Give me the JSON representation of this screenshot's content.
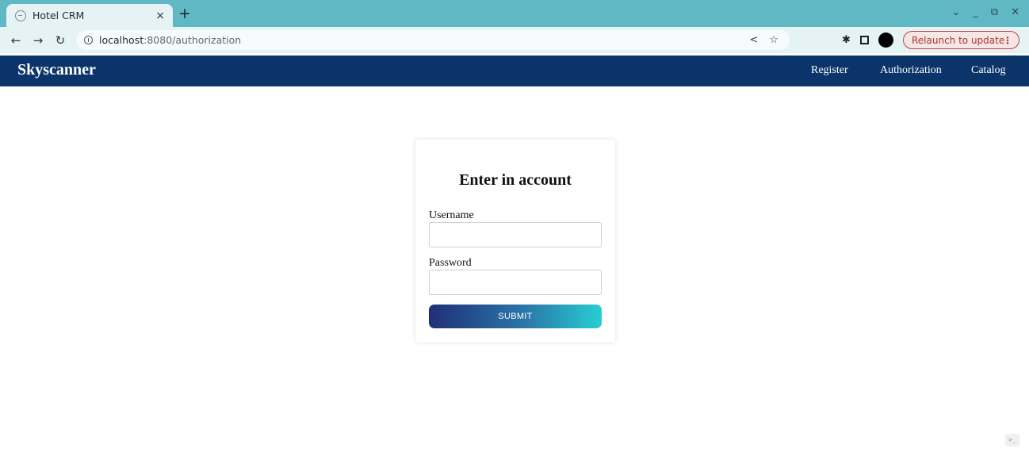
{
  "browser": {
    "tab_title": "Hotel CRM",
    "tab_close": "×",
    "new_tab": "+",
    "url_host": "localhost",
    "url_path": ":8080/authorization",
    "relaunch_label": "Relaunch to update",
    "relaunch_menu": "⋮",
    "icons": [
      "back-arrow-icon",
      "forward-arrow-icon",
      "reload-icon",
      "info-icon",
      "share-icon",
      "star-icon",
      "extensions-icon",
      "sidepanel-icon",
      "profile-avatar"
    ]
  },
  "navbar": {
    "brand": "Skyscanner",
    "links": {
      "register": "Register",
      "authorization": "Authorization",
      "catalog": "Catalog"
    },
    "background": "#0a346a"
  },
  "login": {
    "title": "Enter in account",
    "username_label": "Username",
    "password_label": "Password",
    "username_value": "",
    "password_value": "",
    "submit_label": "SUBMIT"
  },
  "colors": {
    "tabstrip": "#5fb8c3",
    "toolbar": "#e5f3f5",
    "submit_gradient_start": "#1f2f78",
    "submit_gradient_end": "#27ced1",
    "relaunch": "#c0433c"
  }
}
